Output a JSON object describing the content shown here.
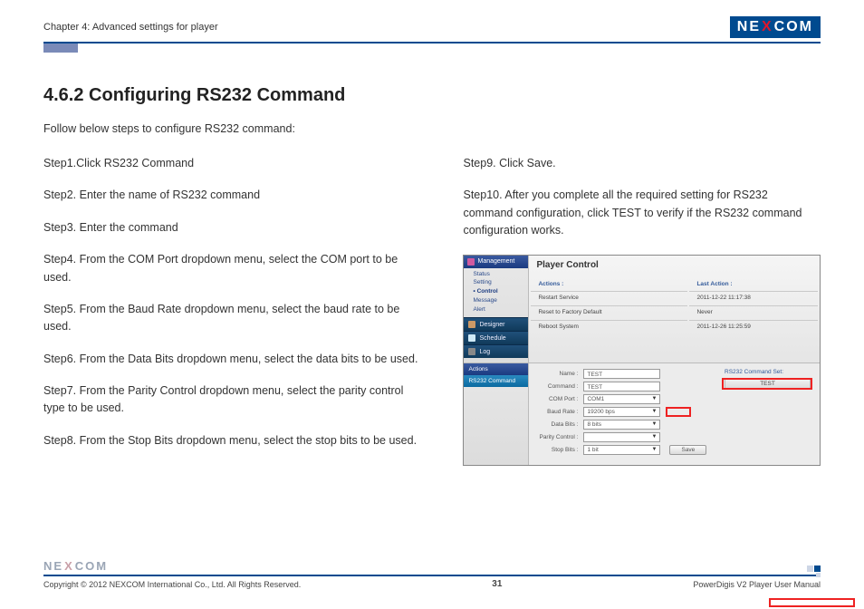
{
  "header": {
    "chapter": "Chapter 4: Advanced settings for player",
    "logo_pre": "NE",
    "logo_x": "X",
    "logo_post": "COM"
  },
  "section": {
    "title": "4.6.2 Configuring RS232 Command",
    "intro": "Follow below steps to configure RS232 command:"
  },
  "steps_left": [
    "Step1.Click RS232 Command",
    "Step2. Enter the name of RS232 command",
    "Step3. Enter the command",
    "Step4. From the COM Port dropdown menu, select the COM port to be used.",
    "Step5. From the Baud Rate dropdown menu, select the baud rate to be used.",
    "Step6. From the Data Bits dropdown menu, select the data bits to be used.",
    "Step7. From the Parity Control dropdown menu, select the parity control type to be used.",
    "Step8. From the Stop Bits dropdown menu, select the stop bits to be used."
  ],
  "steps_right": [
    "Step9. Click Save.",
    "Step10. After you complete all the required setting for RS232 command configuration, click TEST to verify if the RS232 command configuration works."
  ],
  "screenshot": {
    "sidebar": {
      "header": "Management",
      "items": [
        "Status",
        "Setting",
        "Control",
        "Message",
        "Alert"
      ],
      "current_index": 2,
      "rows": [
        "Designer",
        "Schedule",
        "Log"
      ]
    },
    "main": {
      "title": "Player Control",
      "col1_header": "Actions :",
      "col2_header": "Last Action :",
      "rows": [
        {
          "a": "Restart Service",
          "b": "2011-12-22 11:17:38"
        },
        {
          "a": "Reset to Factory Default",
          "b": "Never"
        },
        {
          "a": "Reboot System",
          "b": "2011-12-26 11:25:59"
        }
      ]
    },
    "tabs": {
      "t1": "Actions",
      "t2": "RS232 Command"
    },
    "form": {
      "name_label": "Name :",
      "name_value": "TEST",
      "cmd_label": "Command :",
      "cmd_value": "TEST",
      "com_label": "COM Port :",
      "com_value": "COM1",
      "baud_label": "Baud Rate :",
      "baud_value": "19200 bps",
      "databits_label": "Data Bits :",
      "databits_value": "8 bits",
      "parity_label": "Parity Control :",
      "parity_value": "",
      "stopbits_label": "Stop Bits :",
      "stopbits_value": "1 bit",
      "save": "Save",
      "set_title": "RS232 Command Set:",
      "test": "TEST"
    }
  },
  "footer": {
    "copyright": "Copyright © 2012 NEXCOM International Co., Ltd. All Rights Reserved.",
    "page": "31",
    "manual": "PowerDigis V2 Player User Manual"
  }
}
